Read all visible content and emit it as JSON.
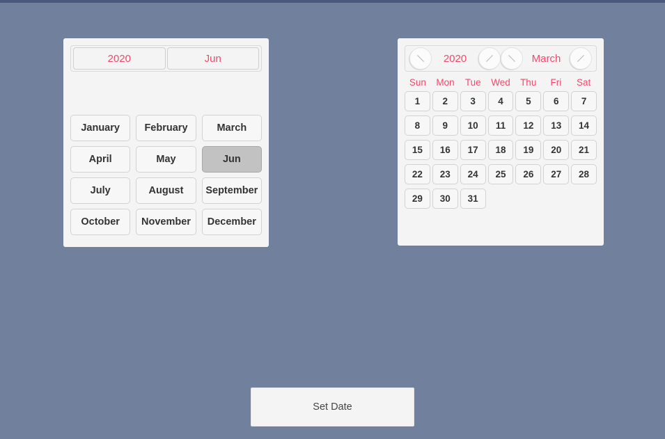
{
  "theme": {
    "background": "#71809c",
    "top_strip": "#4a5a7d",
    "panel_bg": "#f4f4f4",
    "accent_red": "#f2496b",
    "selected_cell": "#c2c2c2",
    "cell_bg": "#f7f7f7",
    "text_dark": "#333333"
  },
  "month_picker": {
    "year_button": {
      "label": "2020",
      "icon": "year-value"
    },
    "month_button": {
      "label": "Jun",
      "icon": "month-value"
    },
    "months": [
      {
        "label": "January",
        "selected": false
      },
      {
        "label": "February",
        "selected": false
      },
      {
        "label": "March",
        "selected": false
      },
      {
        "label": "April",
        "selected": false
      },
      {
        "label": "May",
        "selected": false
      },
      {
        "label": "Jun",
        "selected": true
      },
      {
        "label": "July",
        "selected": false
      },
      {
        "label": "August",
        "selected": false
      },
      {
        "label": "September",
        "selected": false
      },
      {
        "label": "October",
        "selected": false
      },
      {
        "label": "November",
        "selected": false
      },
      {
        "label": "December",
        "selected": false
      }
    ]
  },
  "calendar": {
    "header": {
      "prev_year_icon": "chevron-left-circle-icon",
      "year_label": "2020",
      "next_year_icon": "chevron-right-circle-icon",
      "prev_month_icon": "chevron-left-circle-icon",
      "month_label": "March",
      "next_month_icon": "chevron-right-circle-icon"
    },
    "day_headers": [
      "Sun",
      "Mon",
      "Tue",
      "Wed",
      "Thu",
      "Fri",
      "Sat"
    ],
    "leading_blanks": 0,
    "days": [
      1,
      2,
      3,
      4,
      5,
      6,
      7,
      8,
      9,
      10,
      11,
      12,
      13,
      14,
      15,
      16,
      17,
      18,
      19,
      20,
      21,
      22,
      23,
      24,
      25,
      26,
      27,
      28,
      29,
      30,
      31
    ],
    "selected_day": null
  },
  "footer": {
    "set_date_label": "Set Date"
  }
}
